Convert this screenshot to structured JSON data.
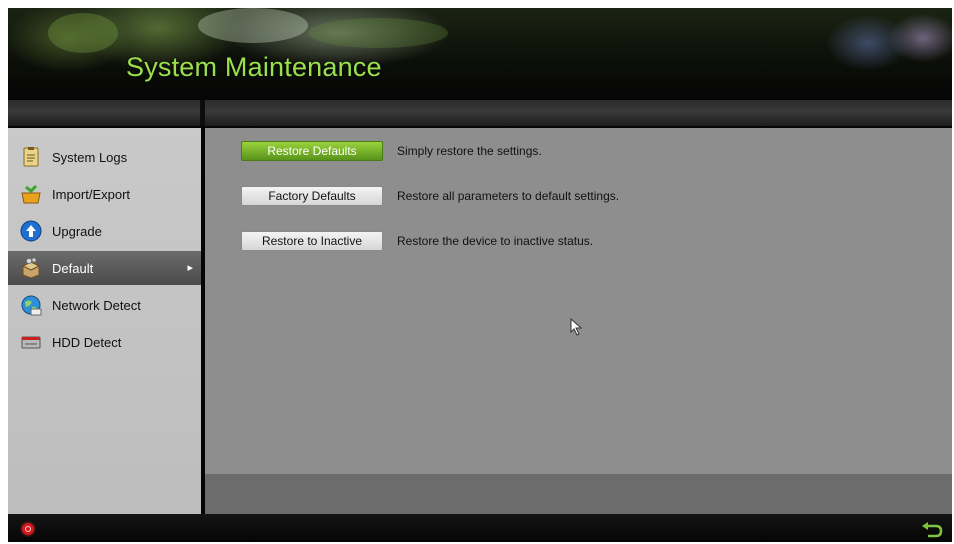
{
  "header": {
    "title": "System Maintenance"
  },
  "sidebar": {
    "items": [
      {
        "label": "System Logs",
        "icon": "log-icon",
        "active": false
      },
      {
        "label": "Import/Export",
        "icon": "import-export-icon",
        "active": false
      },
      {
        "label": "Upgrade",
        "icon": "upgrade-icon",
        "active": false
      },
      {
        "label": "Default",
        "icon": "default-box-icon",
        "active": true
      },
      {
        "label": "Network Detect",
        "icon": "network-globe-icon",
        "active": false
      },
      {
        "label": "HDD Detect",
        "icon": "hdd-icon",
        "active": false
      }
    ]
  },
  "main": {
    "actions": [
      {
        "button": "Restore Defaults",
        "description": "Simply restore the settings.",
        "primary": true
      },
      {
        "button": "Factory Defaults",
        "description": "Restore all parameters to default settings.",
        "primary": false
      },
      {
        "button": "Restore to Inactive",
        "description": "Restore the device to inactive status.",
        "primary": false
      }
    ]
  },
  "statusbar": {
    "left_icon": "power-icon",
    "right_icon": "back-arrow-icon"
  },
  "colors": {
    "title_green": "#9be04c",
    "primary_button": "#58941b",
    "active_item": "#5a5a5a",
    "panel": "#8e8e8e",
    "power_red": "#d4181e"
  }
}
